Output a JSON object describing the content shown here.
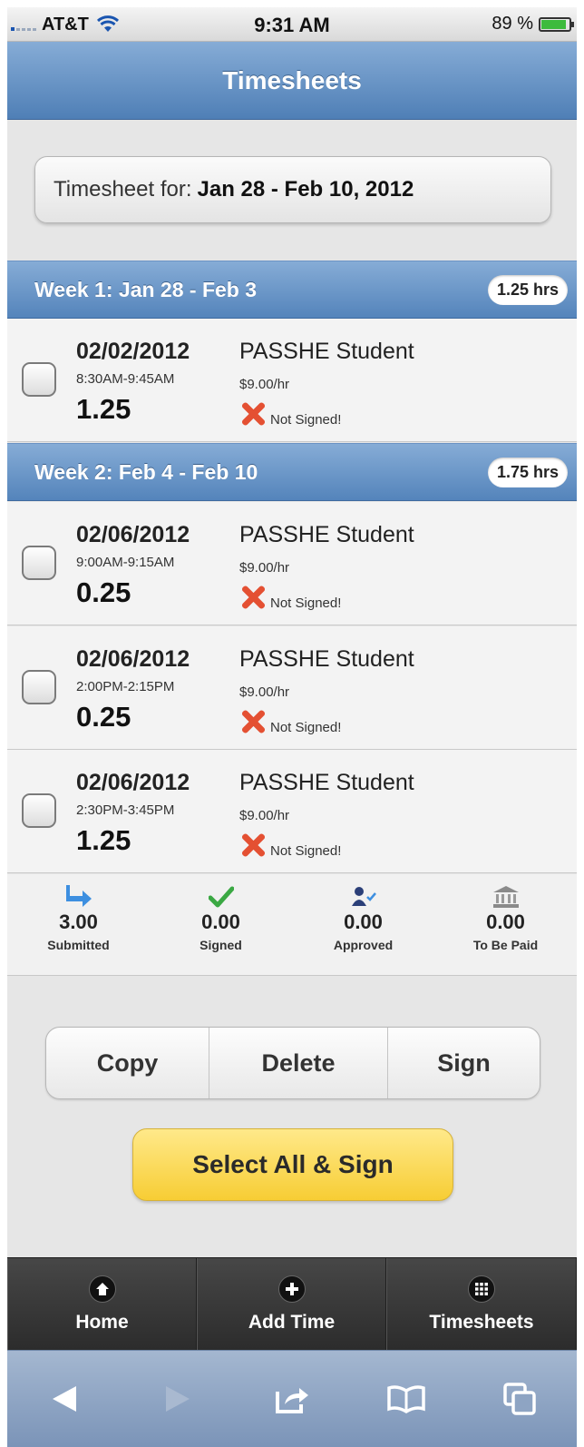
{
  "status_bar": {
    "carrier": "AT&T",
    "time": "9:31 AM",
    "battery": "89 %"
  },
  "header": {
    "title": "Timesheets"
  },
  "period": {
    "label": "Timesheet for:",
    "value": "Jan 28 - Feb 10, 2012"
  },
  "weeks": [
    {
      "title": "Week 1: Jan 28 - Feb 3",
      "total": "1.25 hrs",
      "entries": [
        {
          "date": "02/02/2012",
          "range": "8:30AM-9:45AM",
          "hours": "1.25",
          "job": "PASSHE Student",
          "rate": "$9.00/hr",
          "status": "Not Signed!"
        }
      ]
    },
    {
      "title": "Week 2: Feb 4 - Feb 10",
      "total": "1.75 hrs",
      "entries": [
        {
          "date": "02/06/2012",
          "range": "9:00AM-9:15AM",
          "hours": "0.25",
          "job": "PASSHE Student",
          "rate": "$9.00/hr",
          "status": "Not Signed!"
        },
        {
          "date": "02/06/2012",
          "range": "2:00PM-2:15PM",
          "hours": "0.25",
          "job": "PASSHE Student",
          "rate": "$9.00/hr",
          "status": "Not Signed!"
        },
        {
          "date": "02/06/2012",
          "range": "2:30PM-3:45PM",
          "hours": "1.25",
          "job": "PASSHE Student",
          "rate": "$9.00/hr",
          "status": "Not Signed!"
        }
      ]
    }
  ],
  "summary": [
    {
      "value": "3.00",
      "label": "Submitted",
      "icon": "submitted-arrow-icon"
    },
    {
      "value": "0.00",
      "label": "Signed",
      "icon": "checkmark-icon"
    },
    {
      "value": "0.00",
      "label": "Approved",
      "icon": "approver-icon"
    },
    {
      "value": "0.00",
      "label": "To Be Paid",
      "icon": "bank-icon"
    }
  ],
  "actions": {
    "copy": "Copy",
    "delete": "Delete",
    "sign": "Sign",
    "select_all_sign": "Select All & Sign"
  },
  "tabs": [
    {
      "label": "Home",
      "icon": "home-icon"
    },
    {
      "label": "Add Time",
      "icon": "plus-icon"
    },
    {
      "label": "Timesheets",
      "icon": "grid-icon"
    }
  ],
  "safari_toolbar": [
    "back-icon",
    "forward-icon",
    "share-icon",
    "bookmarks-icon",
    "tabs-icon"
  ],
  "colors": {
    "header_blue": "#5a88bf",
    "status_red": "#e45032",
    "sign_all_yellow": "#f7cd34",
    "tab_bar": "#333333"
  }
}
